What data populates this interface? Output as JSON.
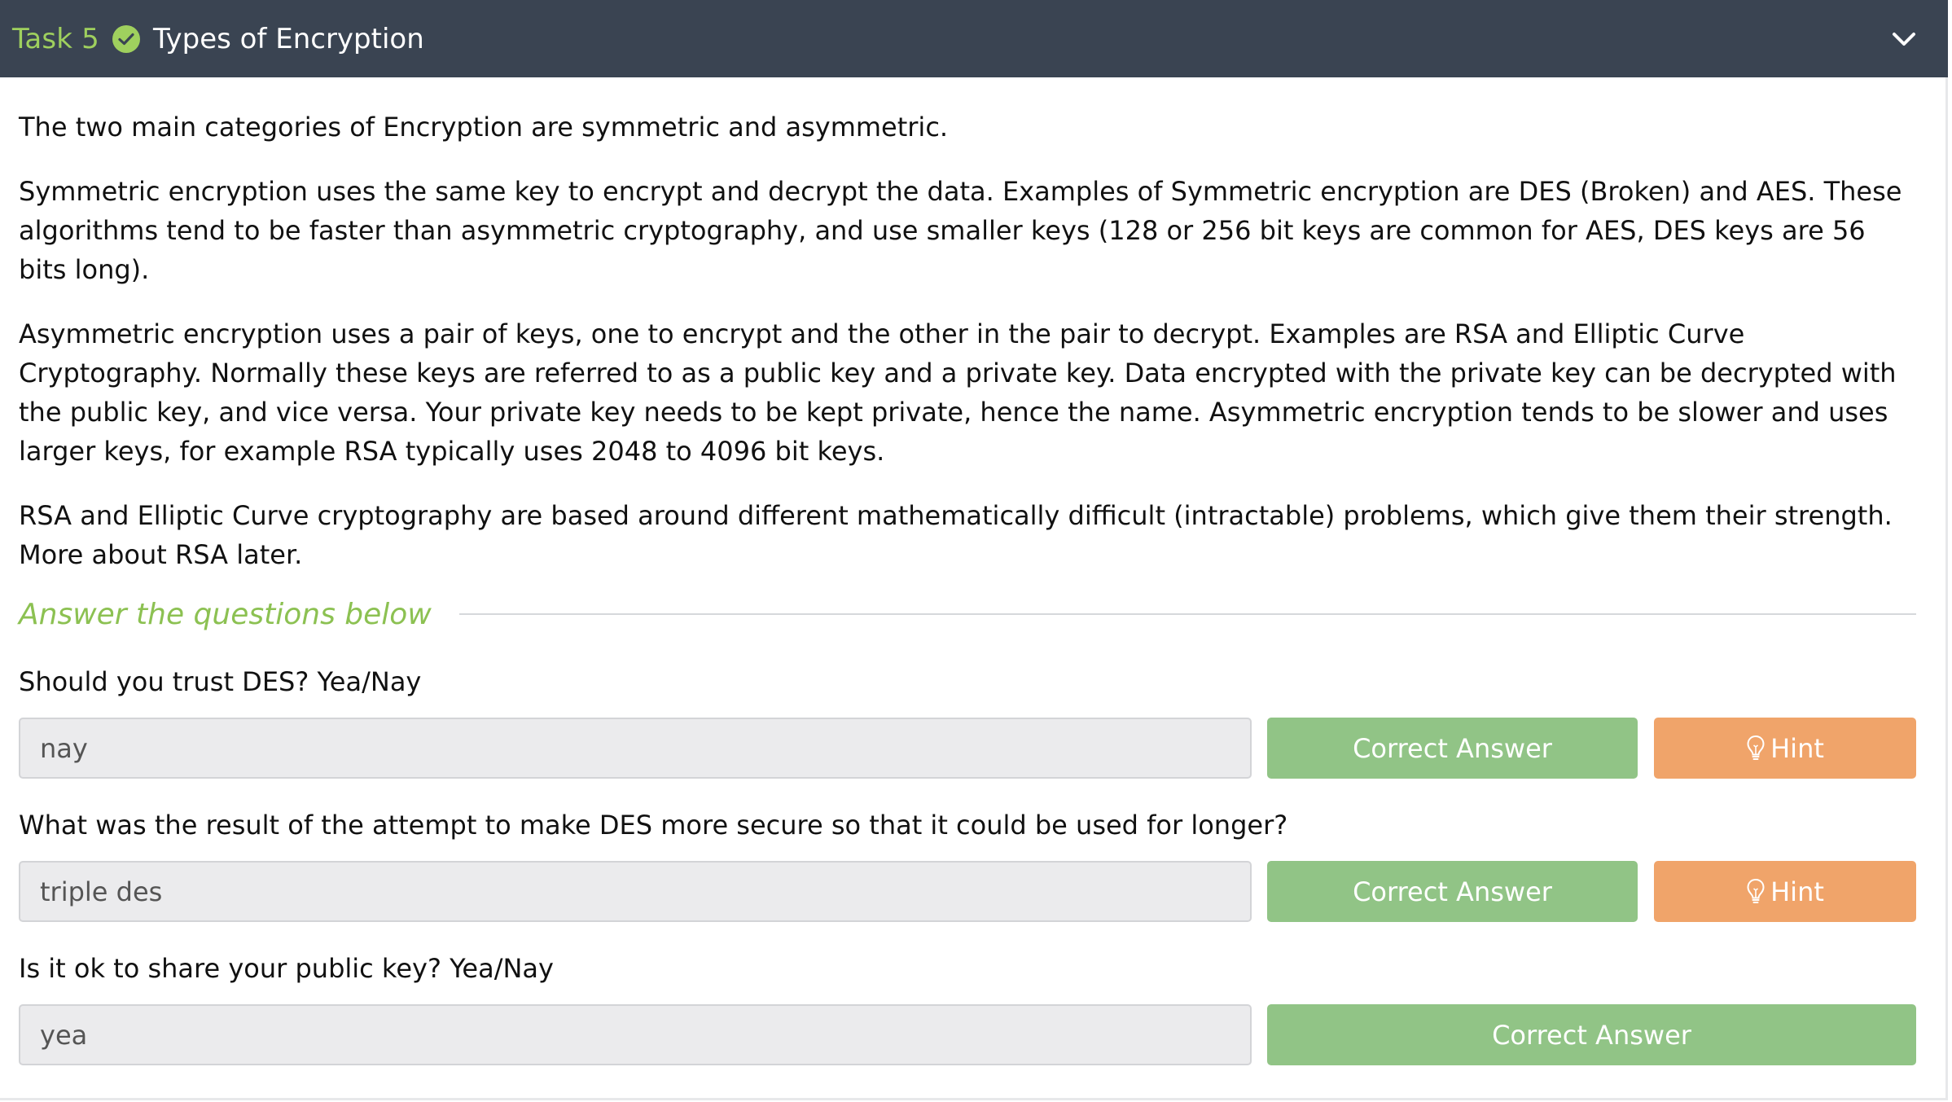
{
  "task": {
    "number_label": "Task 5",
    "title": "Types of Encryption",
    "status_icon": "check-circle-icon",
    "toggle_icon": "chevron-down-icon",
    "accent_color": "#9fd05e",
    "header_bg": "#3a4452"
  },
  "content": {
    "paragraphs": [
      "The two main categories of Encryption are symmetric and asymmetric.",
      "Symmetric encryption uses the same key to encrypt and decrypt the data. Examples of Symmetric encryption are DES (Broken) and AES. These algorithms tend to be faster than asymmetric cryptography, and use smaller keys (128 or 256 bit keys are common for AES, DES keys are 56 bits long).",
      "Asymmetric encryption uses a pair of keys, one to encrypt and the other in the pair to decrypt. Examples are RSA and Elliptic Curve Cryptography. Normally these keys are referred to as a public key and a private key. Data encrypted with the private key can be decrypted with the public key, and vice versa. Your private key needs to be kept private, hence the name. Asymmetric encryption tends to be slower and uses larger keys, for example RSA typically uses 2048 to 4096 bit keys.",
      "RSA and Elliptic Curve cryptography are based around different mathematically difficult (intractable) problems, which give them their strength. More about RSA later."
    ]
  },
  "questions": {
    "heading": "Answer the questions below",
    "items": [
      {
        "question": "Should you trust DES? Yea/Nay",
        "answer_value": "nay",
        "correct_label": "Correct Answer",
        "hint_label": "Hint",
        "has_hint": true
      },
      {
        "question": "What was the result of the attempt to make DES more secure so that it could be used for longer?",
        "answer_value": "triple des",
        "correct_label": "Correct Answer",
        "hint_label": "Hint",
        "has_hint": true
      },
      {
        "question": "Is it ok to share your public key? Yea/Nay",
        "answer_value": "yea",
        "correct_label": "Correct Answer",
        "hint_label": "",
        "has_hint": false
      }
    ],
    "colors": {
      "correct": "#91c486",
      "hint": "#f0a46a",
      "heading": "#8cc152"
    }
  }
}
